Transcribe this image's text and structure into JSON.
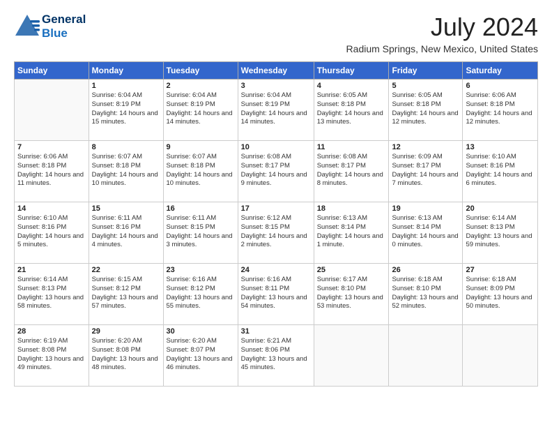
{
  "header": {
    "logo_general": "General",
    "logo_blue": "Blue",
    "month_title": "July 2024",
    "location": "Radium Springs, New Mexico, United States"
  },
  "weekdays": [
    "Sunday",
    "Monday",
    "Tuesday",
    "Wednesday",
    "Thursday",
    "Friday",
    "Saturday"
  ],
  "weeks": [
    [
      {
        "day": "",
        "sunrise": "",
        "sunset": "",
        "daylight": ""
      },
      {
        "day": "1",
        "sunrise": "Sunrise: 6:04 AM",
        "sunset": "Sunset: 8:19 PM",
        "daylight": "Daylight: 14 hours and 15 minutes."
      },
      {
        "day": "2",
        "sunrise": "Sunrise: 6:04 AM",
        "sunset": "Sunset: 8:19 PM",
        "daylight": "Daylight: 14 hours and 14 minutes."
      },
      {
        "day": "3",
        "sunrise": "Sunrise: 6:04 AM",
        "sunset": "Sunset: 8:19 PM",
        "daylight": "Daylight: 14 hours and 14 minutes."
      },
      {
        "day": "4",
        "sunrise": "Sunrise: 6:05 AM",
        "sunset": "Sunset: 8:18 PM",
        "daylight": "Daylight: 14 hours and 13 minutes."
      },
      {
        "day": "5",
        "sunrise": "Sunrise: 6:05 AM",
        "sunset": "Sunset: 8:18 PM",
        "daylight": "Daylight: 14 hours and 12 minutes."
      },
      {
        "day": "6",
        "sunrise": "Sunrise: 6:06 AM",
        "sunset": "Sunset: 8:18 PM",
        "daylight": "Daylight: 14 hours and 12 minutes."
      }
    ],
    [
      {
        "day": "7",
        "sunrise": "Sunrise: 6:06 AM",
        "sunset": "Sunset: 8:18 PM",
        "daylight": "Daylight: 14 hours and 11 minutes."
      },
      {
        "day": "8",
        "sunrise": "Sunrise: 6:07 AM",
        "sunset": "Sunset: 8:18 PM",
        "daylight": "Daylight: 14 hours and 10 minutes."
      },
      {
        "day": "9",
        "sunrise": "Sunrise: 6:07 AM",
        "sunset": "Sunset: 8:18 PM",
        "daylight": "Daylight: 14 hours and 10 minutes."
      },
      {
        "day": "10",
        "sunrise": "Sunrise: 6:08 AM",
        "sunset": "Sunset: 8:17 PM",
        "daylight": "Daylight: 14 hours and 9 minutes."
      },
      {
        "day": "11",
        "sunrise": "Sunrise: 6:08 AM",
        "sunset": "Sunset: 8:17 PM",
        "daylight": "Daylight: 14 hours and 8 minutes."
      },
      {
        "day": "12",
        "sunrise": "Sunrise: 6:09 AM",
        "sunset": "Sunset: 8:17 PM",
        "daylight": "Daylight: 14 hours and 7 minutes."
      },
      {
        "day": "13",
        "sunrise": "Sunrise: 6:10 AM",
        "sunset": "Sunset: 8:16 PM",
        "daylight": "Daylight: 14 hours and 6 minutes."
      }
    ],
    [
      {
        "day": "14",
        "sunrise": "Sunrise: 6:10 AM",
        "sunset": "Sunset: 8:16 PM",
        "daylight": "Daylight: 14 hours and 5 minutes."
      },
      {
        "day": "15",
        "sunrise": "Sunrise: 6:11 AM",
        "sunset": "Sunset: 8:16 PM",
        "daylight": "Daylight: 14 hours and 4 minutes."
      },
      {
        "day": "16",
        "sunrise": "Sunrise: 6:11 AM",
        "sunset": "Sunset: 8:15 PM",
        "daylight": "Daylight: 14 hours and 3 minutes."
      },
      {
        "day": "17",
        "sunrise": "Sunrise: 6:12 AM",
        "sunset": "Sunset: 8:15 PM",
        "daylight": "Daylight: 14 hours and 2 minutes."
      },
      {
        "day": "18",
        "sunrise": "Sunrise: 6:13 AM",
        "sunset": "Sunset: 8:14 PM",
        "daylight": "Daylight: 14 hours and 1 minute."
      },
      {
        "day": "19",
        "sunrise": "Sunrise: 6:13 AM",
        "sunset": "Sunset: 8:14 PM",
        "daylight": "Daylight: 14 hours and 0 minutes."
      },
      {
        "day": "20",
        "sunrise": "Sunrise: 6:14 AM",
        "sunset": "Sunset: 8:13 PM",
        "daylight": "Daylight: 13 hours and 59 minutes."
      }
    ],
    [
      {
        "day": "21",
        "sunrise": "Sunrise: 6:14 AM",
        "sunset": "Sunset: 8:13 PM",
        "daylight": "Daylight: 13 hours and 58 minutes."
      },
      {
        "day": "22",
        "sunrise": "Sunrise: 6:15 AM",
        "sunset": "Sunset: 8:12 PM",
        "daylight": "Daylight: 13 hours and 57 minutes."
      },
      {
        "day": "23",
        "sunrise": "Sunrise: 6:16 AM",
        "sunset": "Sunset: 8:12 PM",
        "daylight": "Daylight: 13 hours and 55 minutes."
      },
      {
        "day": "24",
        "sunrise": "Sunrise: 6:16 AM",
        "sunset": "Sunset: 8:11 PM",
        "daylight": "Daylight: 13 hours and 54 minutes."
      },
      {
        "day": "25",
        "sunrise": "Sunrise: 6:17 AM",
        "sunset": "Sunset: 8:10 PM",
        "daylight": "Daylight: 13 hours and 53 minutes."
      },
      {
        "day": "26",
        "sunrise": "Sunrise: 6:18 AM",
        "sunset": "Sunset: 8:10 PM",
        "daylight": "Daylight: 13 hours and 52 minutes."
      },
      {
        "day": "27",
        "sunrise": "Sunrise: 6:18 AM",
        "sunset": "Sunset: 8:09 PM",
        "daylight": "Daylight: 13 hours and 50 minutes."
      }
    ],
    [
      {
        "day": "28",
        "sunrise": "Sunrise: 6:19 AM",
        "sunset": "Sunset: 8:08 PM",
        "daylight": "Daylight: 13 hours and 49 minutes."
      },
      {
        "day": "29",
        "sunrise": "Sunrise: 6:20 AM",
        "sunset": "Sunset: 8:08 PM",
        "daylight": "Daylight: 13 hours and 48 minutes."
      },
      {
        "day": "30",
        "sunrise": "Sunrise: 6:20 AM",
        "sunset": "Sunset: 8:07 PM",
        "daylight": "Daylight: 13 hours and 46 minutes."
      },
      {
        "day": "31",
        "sunrise": "Sunrise: 6:21 AM",
        "sunset": "Sunset: 8:06 PM",
        "daylight": "Daylight: 13 hours and 45 minutes."
      },
      {
        "day": "",
        "sunrise": "",
        "sunset": "",
        "daylight": ""
      },
      {
        "day": "",
        "sunrise": "",
        "sunset": "",
        "daylight": ""
      },
      {
        "day": "",
        "sunrise": "",
        "sunset": "",
        "daylight": ""
      }
    ]
  ]
}
